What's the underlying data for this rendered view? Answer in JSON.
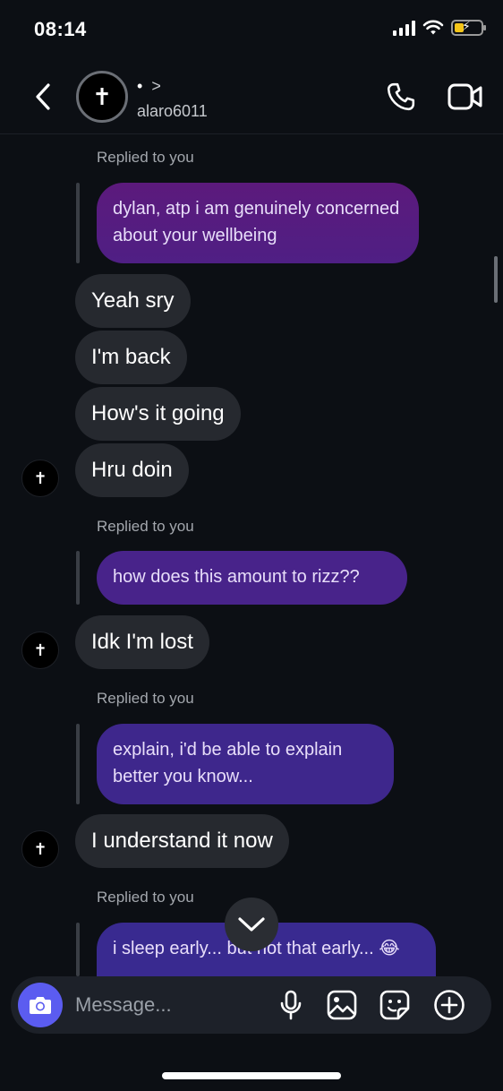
{
  "status": {
    "time": "08:14"
  },
  "header": {
    "name_dot": "•",
    "name_chevron": ">",
    "username": "alaro6011",
    "avatar_glyph": "✝"
  },
  "chat": {
    "reply_label": "Replied to you",
    "replies": [
      "dylan, atp i am genuinely concerned about your wellbeing",
      "how does this amount to rizz??",
      "explain, i'd be able to explain better you know...",
      "i sleep early... but not that early... 😂"
    ],
    "incoming": [
      "Yeah sry",
      "I'm back",
      "How's it going",
      "Hru doin",
      "Idk I'm lost",
      "I understand it now"
    ],
    "avatar_glyph": "✝"
  },
  "composer": {
    "placeholder": "Message..."
  },
  "colors": {
    "outgoing_bubble_top": "#5b1a7a",
    "outgoing_bubble_bottom": "#3d2a8f",
    "incoming_bubble": "#26292f",
    "camera_button": "#5b5cf0"
  },
  "icons": [
    "back-icon",
    "phone-icon",
    "video-icon",
    "camera-icon",
    "mic-icon",
    "gallery-icon",
    "sticker-icon",
    "plus-icon",
    "chevron-down-icon"
  ]
}
